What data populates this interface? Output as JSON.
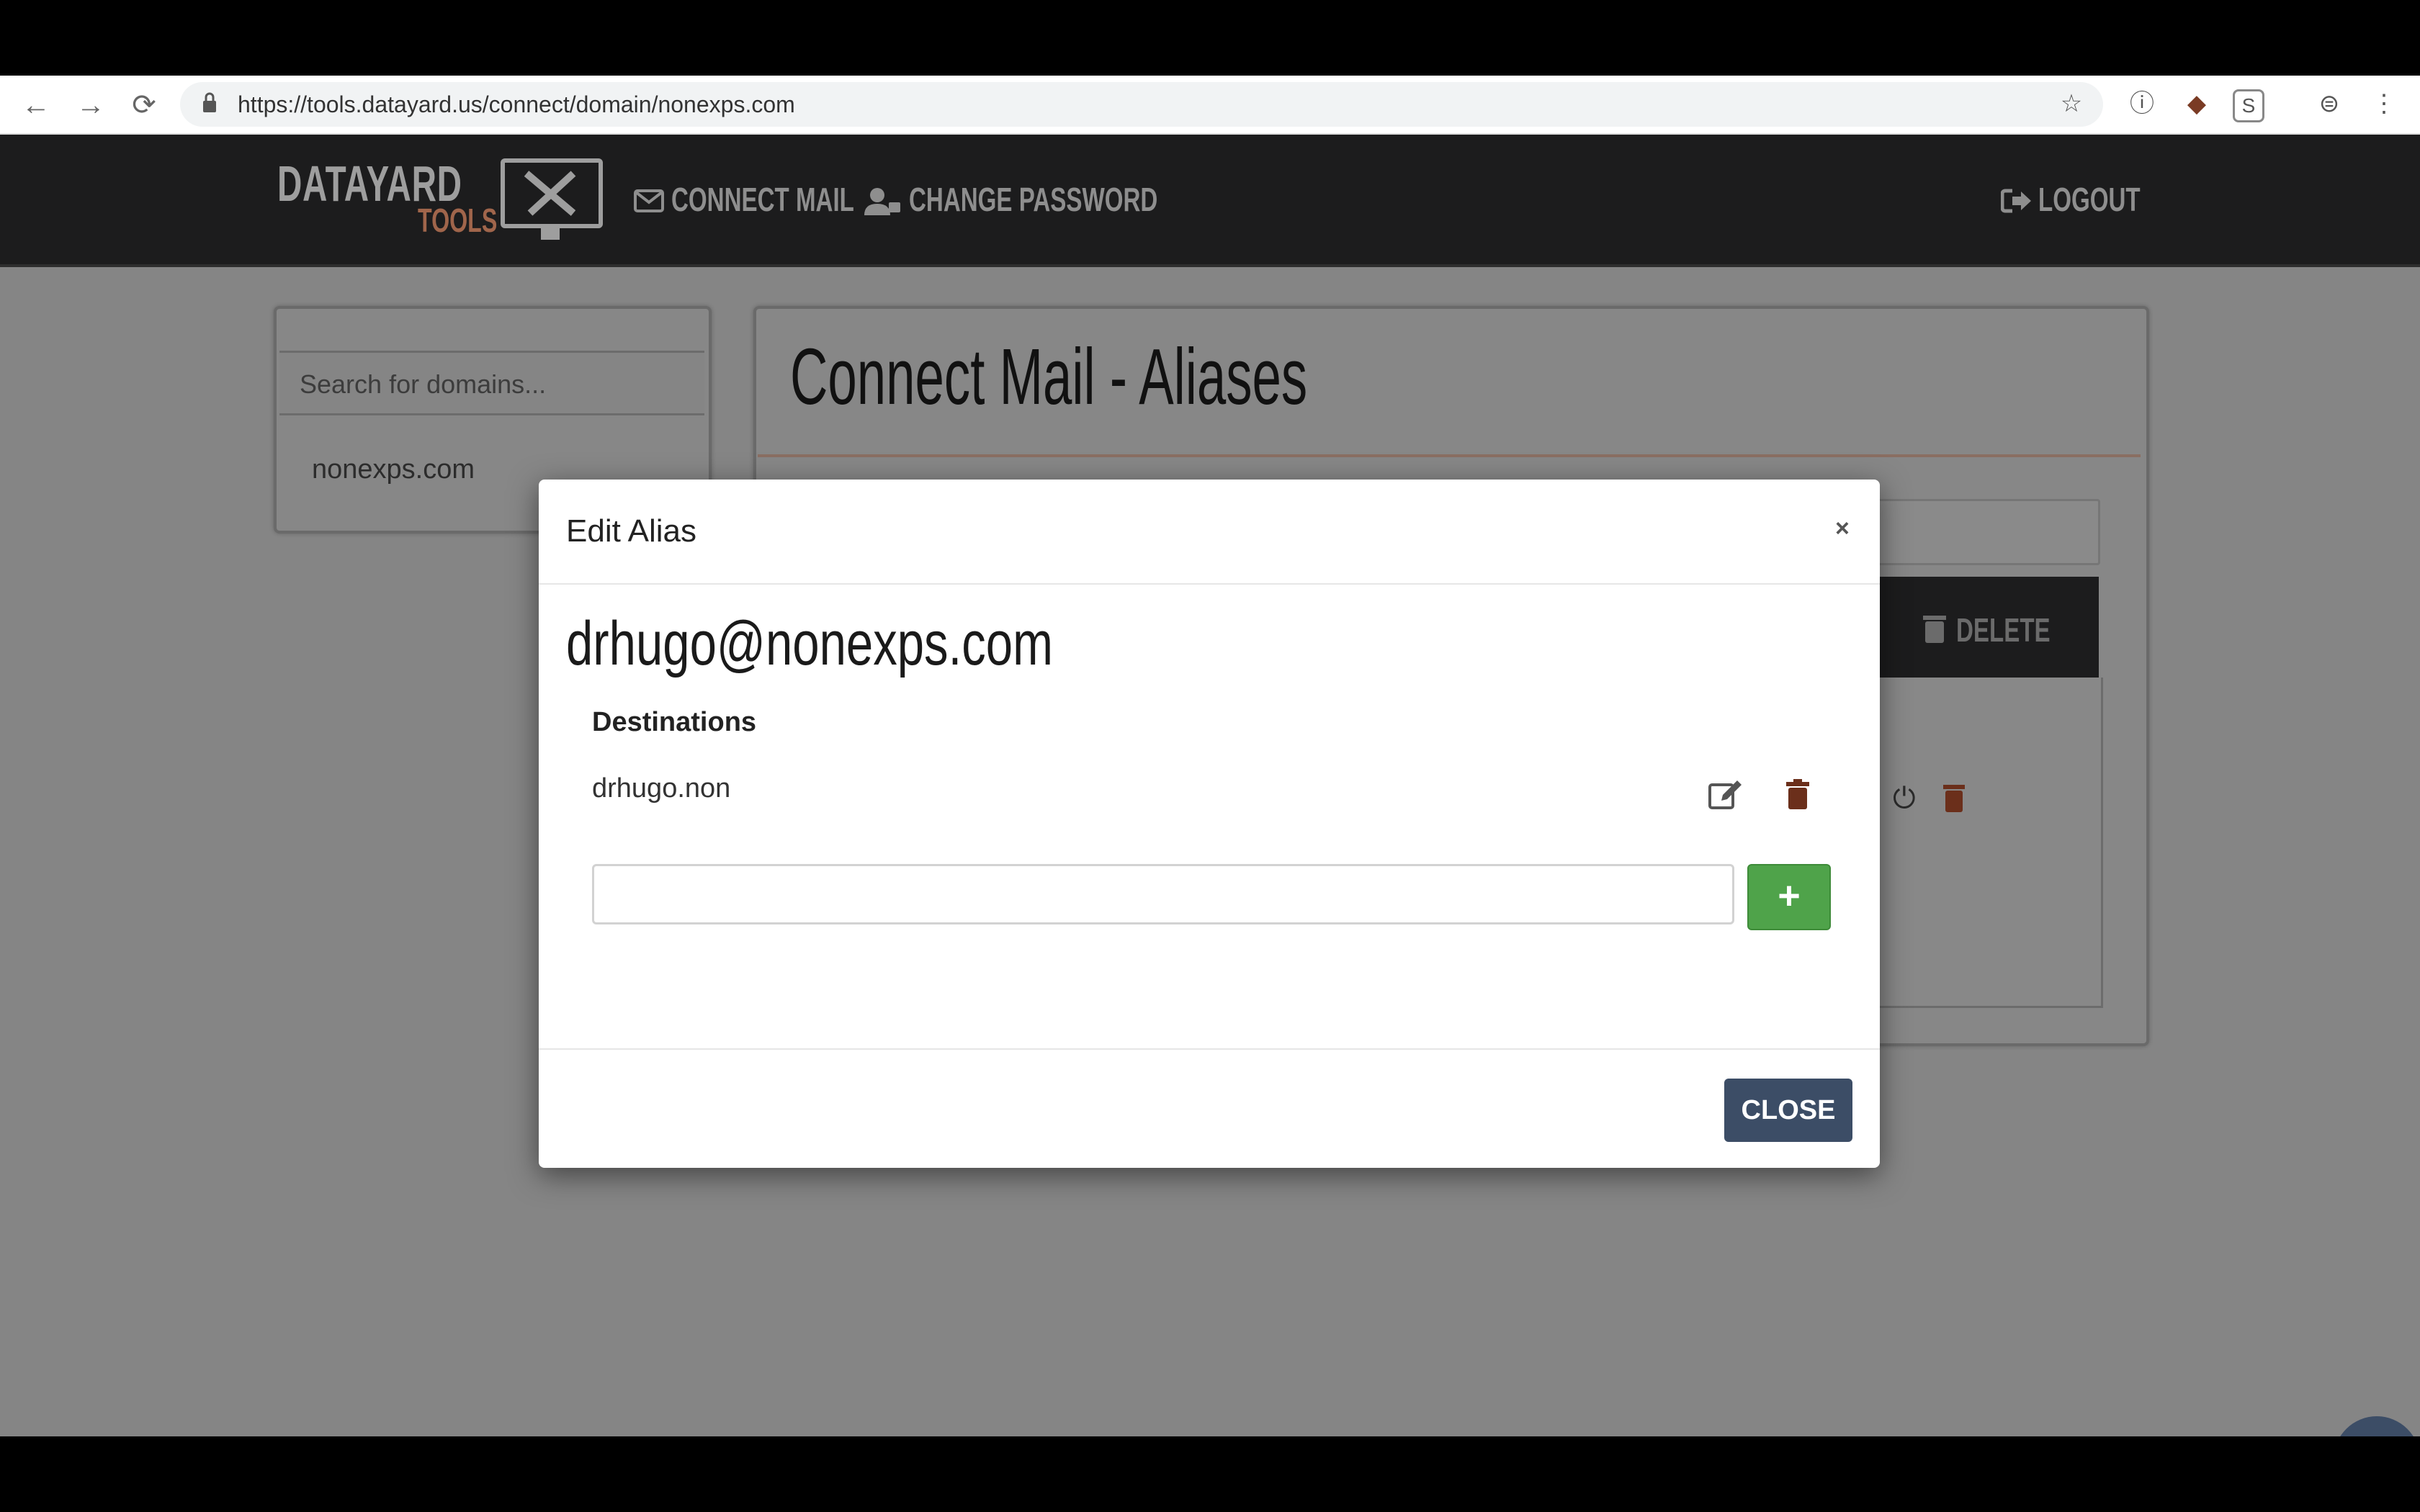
{
  "browser": {
    "url": "https://tools.datayard.us/connect/domain/nonexps.com",
    "back_icon": "←",
    "forward_icon": "→",
    "reload_icon": "⟳",
    "star_icon": "☆",
    "ext1_icon": "ⓘ",
    "ext2_icon": "◆",
    "ext3_icon": "S",
    "ext4_icon": "⊜",
    "menu_icon": "⋮"
  },
  "navbar": {
    "logo_main": "DATAYARD",
    "logo_sub": "TOOLS",
    "connect_mail": "CONNECT MAIL",
    "change_password": "CHANGE PASSWORD",
    "logout": "LOGOUT"
  },
  "sidebar": {
    "search_placeholder": "Search for domains...",
    "domains": [
      "nonexps.com"
    ]
  },
  "main": {
    "title": "Connect Mail - Aliases",
    "delete_label": "DELETE"
  },
  "modal": {
    "title": "Edit Alias",
    "close_x": "×",
    "alias_address": "drhugo@nonexps.com",
    "destinations_label": "Destinations",
    "destinations": [
      "drhugo.non"
    ],
    "new_destination_value": "",
    "add_label": "+",
    "close_label": "CLOSE"
  },
  "colors": {
    "navbar_bg": "#1c1c1d",
    "logo_accent": "#a0654b",
    "add_button": "#4fa34a",
    "close_button": "#3c4d66",
    "trash_icon": "#6b2f1b"
  }
}
